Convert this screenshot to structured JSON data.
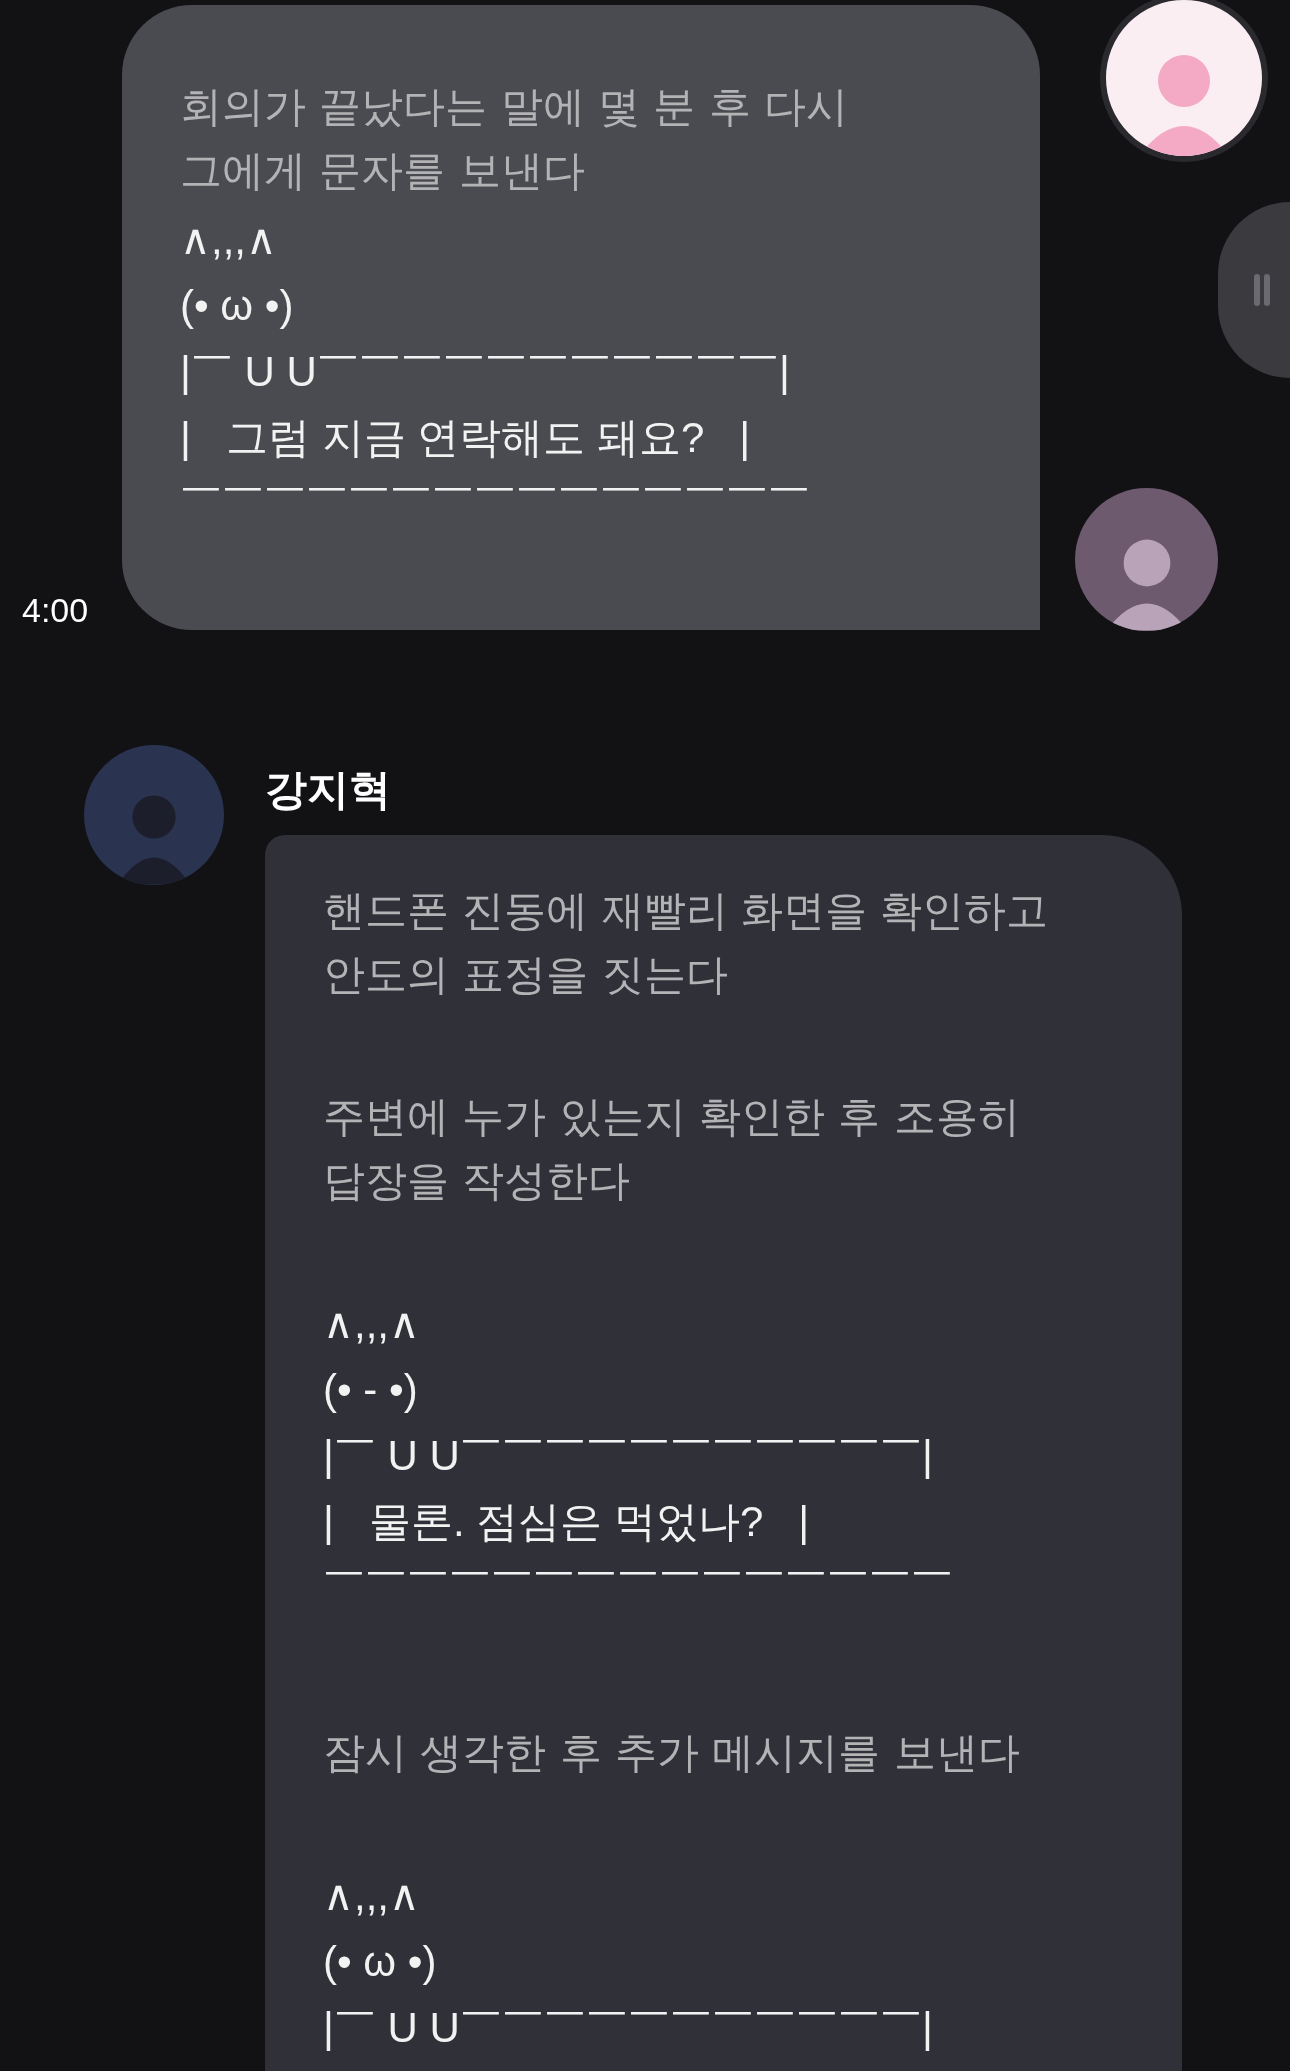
{
  "messages": [
    {
      "kind": "user",
      "time": "4:00",
      "blocks": [
        {
          "kind": "narration",
          "lines": [
            "회의가 끝났다는 말에 몇 분 후 다시",
            "그에게 문자를 보낸다"
          ]
        },
        {
          "kind": "art",
          "lines": [
            "∧,,,∧",
            "(• ω •)",
            "|￣ U U￣￣￣￣￣￣￣￣￣￣￣|",
            "|   그럼 지금 연락해도 돼요?   |",
            "￣￣￣￣￣￣￣￣￣￣￣￣￣￣￣"
          ]
        }
      ]
    },
    {
      "kind": "character",
      "name": "강지혁",
      "blocks": [
        {
          "kind": "narration",
          "lines": [
            "핸드폰 진동에 재빨리 화면을 확인하고",
            "안도의 표정을 짓는다"
          ]
        },
        {
          "kind": "narration",
          "lines": [
            "주변에 누가 있는지 확인한 후 조용히",
            "답장을 작성한다"
          ]
        },
        {
          "kind": "art",
          "lines": [
            "∧,,,∧",
            "(• - •)",
            "|￣ U U￣￣￣￣￣￣￣￣￣￣￣|",
            "|   물론. 점심은 먹었나?   |",
            "￣￣￣￣￣￣￣￣￣￣￣￣￣￣￣"
          ]
        },
        {
          "kind": "narration",
          "lines": [
            "잠시 생각한 후 추가 메시지를 보낸다"
          ]
        },
        {
          "kind": "art",
          "lines": [
            "∧,,,∧",
            "(• ω •)",
            "|￣ U U￣￣￣￣￣￣￣￣￣￣￣|"
          ]
        }
      ]
    }
  ]
}
